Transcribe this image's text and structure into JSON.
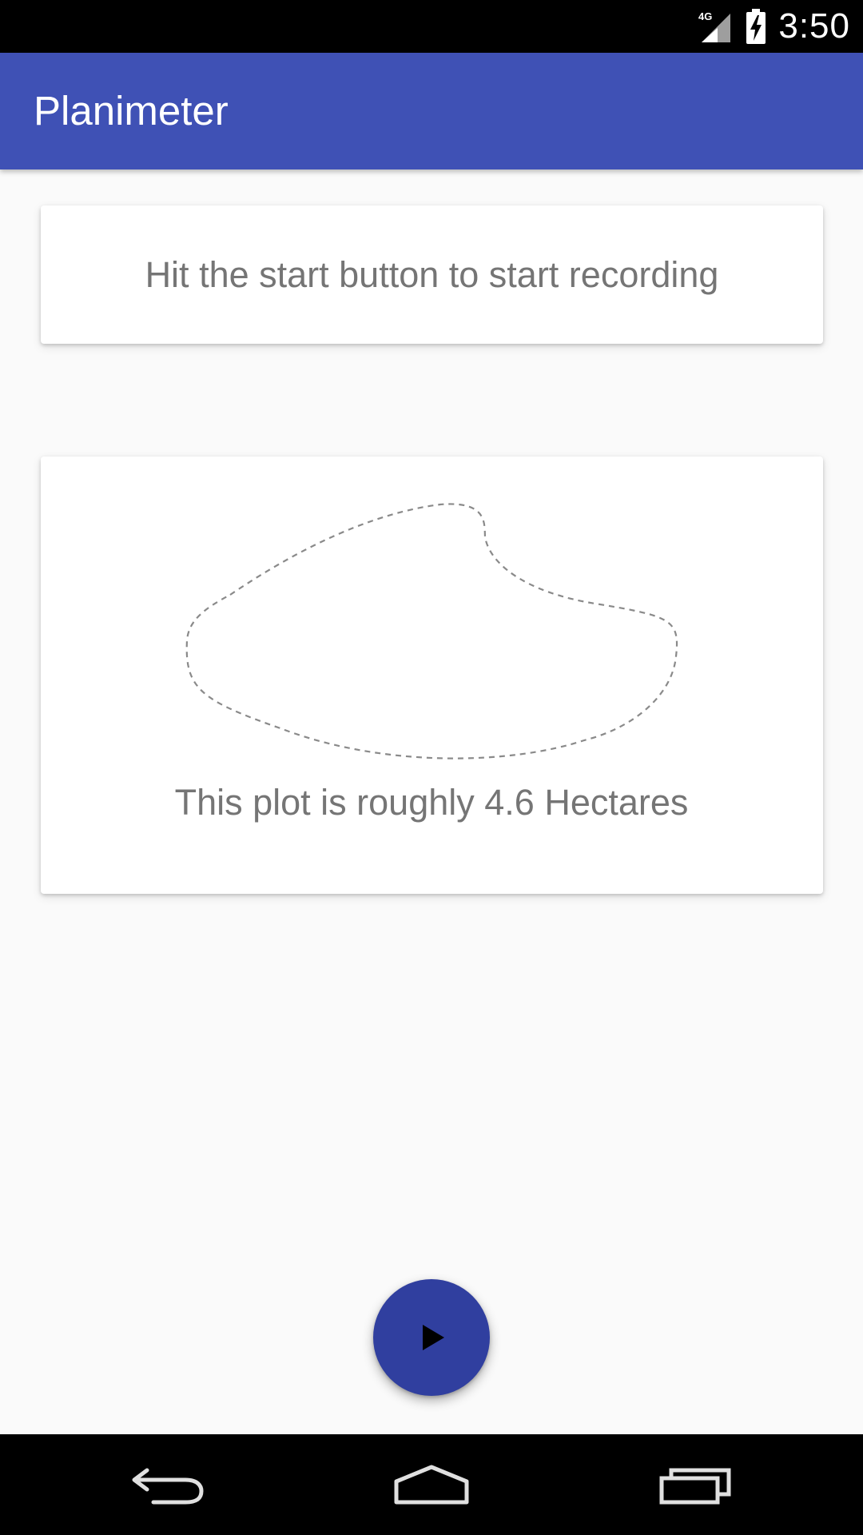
{
  "status_bar": {
    "network": "4G",
    "time": "3:50",
    "icons": [
      "signal-icon",
      "battery-charging-icon"
    ]
  },
  "app_bar": {
    "title": "Planimeter",
    "color": "#3f51b5"
  },
  "instruction_card": {
    "text": "Hit the start button to start recording"
  },
  "plot_card": {
    "area_text": "This plot is roughly 4.6 Hectares"
  },
  "fab": {
    "icon": "play-icon",
    "color": "#303f9f"
  },
  "nav_bar": {
    "buttons": [
      "back-icon",
      "home-icon",
      "recents-icon"
    ]
  }
}
